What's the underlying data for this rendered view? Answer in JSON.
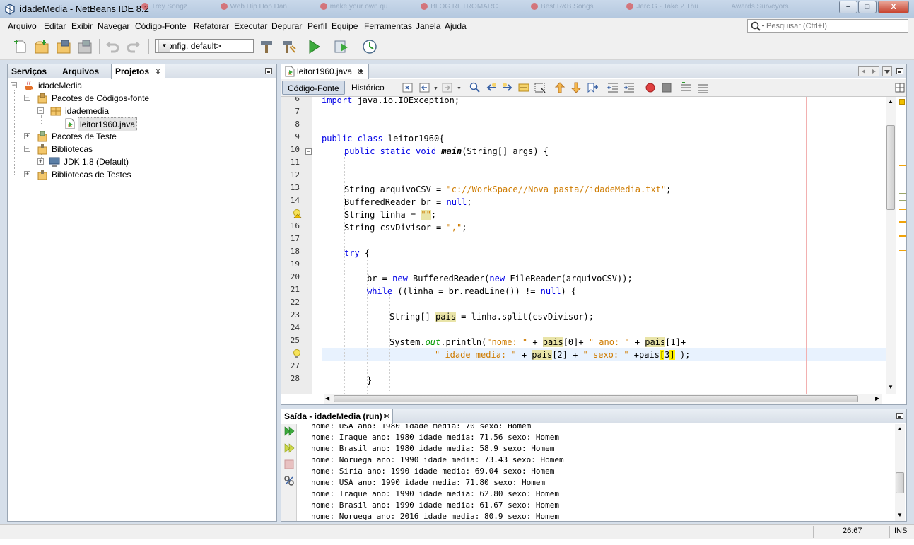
{
  "window": {
    "title": "idadeMedia - NetBeans IDE 8.2",
    "background_tabs": [
      "Trey Songz",
      "Web Hip Hop Dan",
      "make your own qu",
      "BLOG RETROMARC",
      "Best R&B Songs",
      "Jerc G - Take 2 Thu",
      "Awards Surveyors"
    ],
    "controls": {
      "minimize": "−",
      "maximize": "□",
      "close": "X"
    }
  },
  "menu": {
    "items": [
      "Arquivo",
      "Editar",
      "Exibir",
      "Navegar",
      "Código-Fonte",
      "Refatorar",
      "Executar",
      "Depurar",
      "Perfil",
      "Equipe",
      "Ferramentas",
      "Janela",
      "Ajuda"
    ],
    "search_placeholder": "Pesquisar (Ctrl+I)"
  },
  "toolbar": {
    "config_value": "<config. default>",
    "icons": [
      "new-file-icon",
      "new-project-icon",
      "open-project-icon",
      "close-project-icon",
      "undo-icon",
      "redo-icon",
      "build-icon",
      "clean-build-icon",
      "run-icon",
      "debug-icon",
      "profile-icon"
    ]
  },
  "projects_panel": {
    "tabs": [
      "Serviços",
      "Arquivos",
      "Projetos"
    ],
    "active_tab": "Projetos",
    "tree": [
      {
        "label": "idadeMedia"
      },
      {
        "label": "Pacotes de Códigos-fonte"
      },
      {
        "label": "idademedia"
      },
      {
        "label": "leitor1960.java"
      },
      {
        "label": "Pacotes de Teste"
      },
      {
        "label": "Bibliotecas"
      },
      {
        "label": "JDK 1.8 (Default)"
      },
      {
        "label": "Bibliotecas de Testes"
      }
    ]
  },
  "editor": {
    "tab_label": "leitor1960.java",
    "modes": [
      "Código-Fonte",
      "Histórico"
    ],
    "active_mode": "Código-Fonte",
    "line_numbers": [
      "6",
      "7",
      "8",
      "9",
      "10",
      "11",
      "12",
      "13",
      "14",
      "15",
      "16",
      "17",
      "18",
      "19",
      "20",
      "21",
      "22",
      "23",
      "24",
      "25",
      "26",
      "27",
      "28"
    ],
    "code": {
      "l6": [
        "import",
        " java.io.IOException;"
      ],
      "l9": [
        "public class",
        " leitor1960{"
      ],
      "l10": [
        "public static void",
        " ",
        "main",
        "(String[] args) {"
      ],
      "l13": [
        "String arquivoCSV = ",
        "\"c://WorkSpace//Nova pasta//idadeMedia.txt\"",
        ";"
      ],
      "l14": [
        "BufferedReader br = ",
        "null",
        ";"
      ],
      "l15": [
        "String linha = ",
        "\"\"",
        ";"
      ],
      "l16": [
        "String csvDivisor = ",
        "\",\"",
        ";"
      ],
      "l18": [
        "try",
        " {"
      ],
      "l20": [
        "br = ",
        "new",
        " BufferedReader(",
        "new",
        " FileReader(arquivoCSV));"
      ],
      "l21": [
        "while",
        " ((linha = br.readLine()) != ",
        "null",
        ") {"
      ],
      "l23": [
        "String[] ",
        "pais",
        " = linha.split(csvDivisor);"
      ],
      "l25": [
        "System.",
        "out",
        ".println(",
        "\"nome: \"",
        " + ",
        "pais",
        "[0]+ ",
        "\" ano: \"",
        " + ",
        "pais",
        "[1]+"
      ],
      "l26": [
        "\" idade media: \"",
        " + ",
        "pais",
        "[2] + ",
        "\" sexo: \"",
        " +pais",
        "[",
        "3",
        "]",
        " );"
      ],
      "l28": [
        "}"
      ]
    }
  },
  "output": {
    "tab_label": "Saída - idadeMedia (run)",
    "lines": [
      "nome: USA ano: 1980 idade media: 70 sexo: Homem",
      "nome: Iraque ano: 1980 idade media: 71.56 sexo: Homem",
      "nome: Brasil ano: 1980 idade media: 58.9 sexo: Homem",
      "nome: Noruega ano: 1990 idade media: 73.43 sexo: Homem",
      "nome: Siria ano: 1990 idade media: 69.04 sexo: Homem",
      "nome: USA ano: 1990 idade media: 71.80 sexo: Homem",
      "nome: Iraque ano: 1990 idade media: 62.80 sexo: Homem",
      "nome: Brasil ano: 1990 idade media: 61.67 sexo: Homem",
      "nome: Noruega ano: 2016 idade media: 80.9 sexo: Homem"
    ]
  },
  "status": {
    "position": "26:67",
    "insert_mode": "INS"
  },
  "colors": {
    "keyword": "#0000e6",
    "string": "#ce7b00",
    "highlight": "#e9e4a8",
    "current_line": "#e8f2fe"
  }
}
